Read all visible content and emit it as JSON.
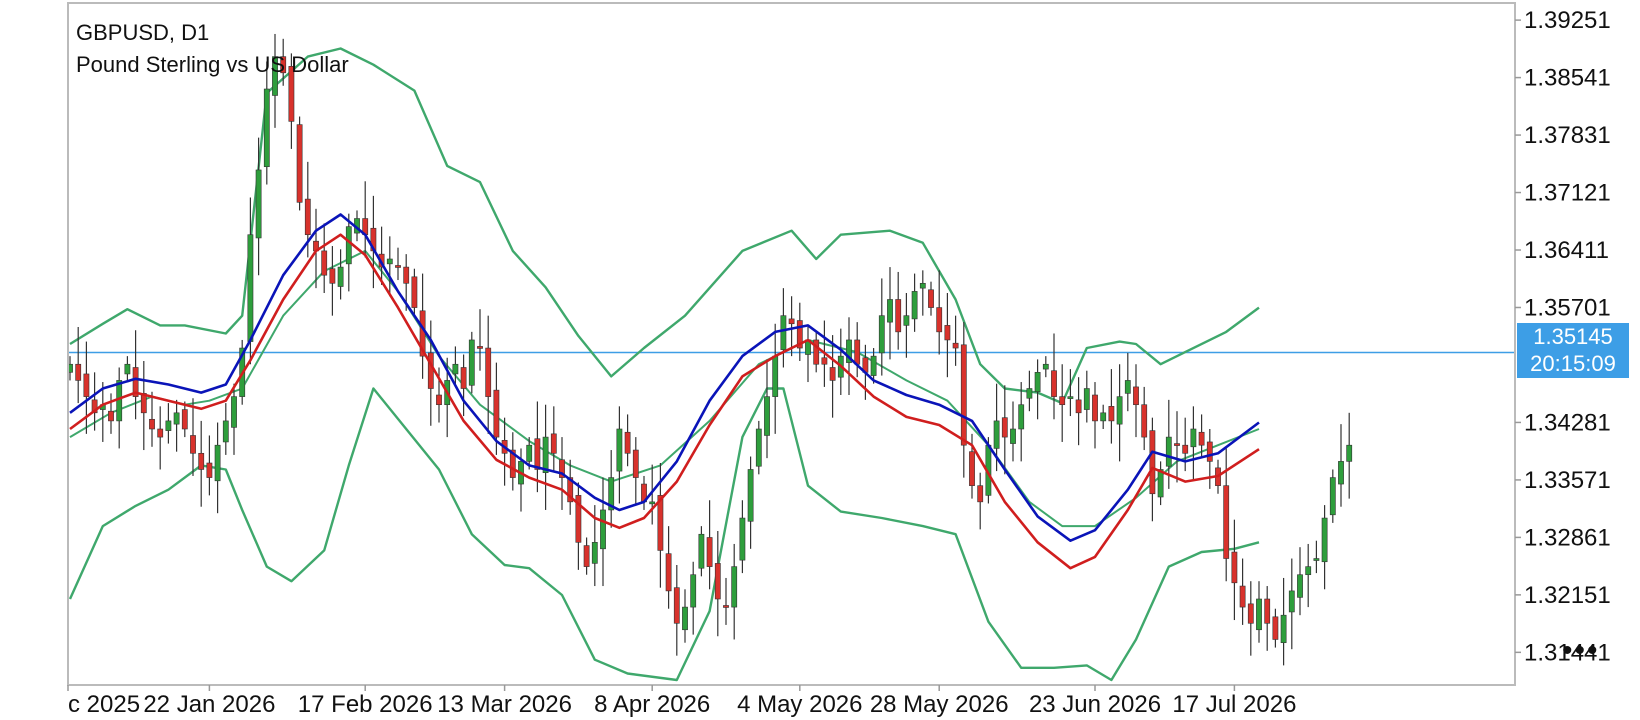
{
  "header": {
    "symbol": "GBPUSD, D1",
    "description": "Pound Sterling vs US Dollar"
  },
  "price_tag": {
    "price": "1.35145",
    "countdown": "20:15:09"
  },
  "menu": {
    "icon": "more-dots-icon",
    "glyph": "•••"
  },
  "colors": {
    "bull": "#2e9e3c",
    "bear": "#d8322c",
    "fast_ma": "#0a14b8",
    "slow_ma": "#d01e1e",
    "bands": "#3fa86c",
    "price_line": "#3d9ee6",
    "frame": "#bbbbbb"
  },
  "chart_data": {
    "type": "candlestick",
    "symbol": "GBPUSD",
    "timeframe": "D1",
    "current_price": 1.35145,
    "ylim": [
      1.3105,
      1.3945
    ],
    "y_ticks": [
      "1.39251",
      "1.38541",
      "1.37831",
      "1.37121",
      "1.36411",
      "1.35701",
      "1.34281",
      "1.33571",
      "1.32861",
      "1.32151",
      "1.31441"
    ],
    "x_ticks": [
      {
        "bar": 0,
        "label": "c 2025"
      },
      {
        "bar": 17,
        "label": "22 Jan 2026"
      },
      {
        "bar": 36,
        "label": "17 Feb 2026"
      },
      {
        "bar": 53,
        "label": "13 Mar 2026"
      },
      {
        "bar": 71,
        "label": "8 Apr 2026"
      },
      {
        "bar": 89,
        "label": "4 May 2026"
      },
      {
        "bar": 106,
        "label": "28 May 2026"
      },
      {
        "bar": 125,
        "label": "23 Jun 2026"
      },
      {
        "bar": 142,
        "label": "17 Jul 2026"
      }
    ],
    "ohlc_closes": [
      1.35,
      1.348,
      1.346,
      1.344,
      1.345,
      1.343,
      1.348,
      1.35,
      1.346,
      1.344,
      1.342,
      1.341,
      1.343,
      1.344,
      1.342,
      1.339,
      1.337,
      1.336,
      1.34,
      1.343,
      1.346,
      1.352,
      1.366,
      1.374,
      1.384,
      1.388,
      1.386,
      1.38,
      1.37,
      1.366,
      1.364,
      1.361,
      1.36,
      1.362,
      1.367,
      1.368,
      1.366,
      1.364,
      1.362,
      1.363,
      1.362,
      1.36,
      1.357,
      1.351,
      1.347,
      1.345,
      1.348,
      1.35,
      1.347,
      1.353,
      1.352,
      1.346,
      1.341,
      1.339,
      1.336,
      1.338,
      1.34,
      1.337,
      1.341,
      1.339,
      1.336,
      1.333,
      1.328,
      1.325,
      1.328,
      1.332,
      1.336,
      1.342,
      1.339,
      1.336,
      1.333,
      1.333,
      1.327,
      1.322,
      1.318,
      1.32,
      1.324,
      1.329,
      1.325,
      1.321,
      1.32,
      1.325,
      1.331,
      1.337,
      1.342,
      1.346,
      1.351,
      1.356,
      1.355,
      1.352,
      1.353,
      1.35,
      1.35,
      1.348,
      1.351,
      1.353,
      1.35,
      1.349,
      1.351,
      1.356,
      1.358,
      1.354,
      1.356,
      1.359,
      1.36,
      1.357,
      1.354,
      1.353,
      1.352,
      1.34,
      1.335,
      1.333,
      1.34,
      1.343,
      1.341,
      1.342,
      1.345,
      1.347,
      1.349,
      1.35,
      1.346,
      1.345,
      1.346,
      1.344,
      1.347,
      1.343,
      1.344,
      1.343,
      1.346,
      1.348,
      1.345,
      1.341,
      1.334,
      1.337,
      1.341,
      1.34,
      1.339,
      1.342,
      1.34,
      1.338,
      1.335,
      1.326,
      1.323,
      1.32,
      1.318,
      1.321,
      1.318,
      1.316,
      1.319,
      1.322,
      1.324,
      1.325,
      1.326,
      1.331,
      1.336,
      1.338,
      1.34
    ],
    "series": [
      {
        "name": "fast MA",
        "color": "fast_ma"
      },
      {
        "name": "slow MA",
        "color": "slow_ma"
      },
      {
        "name": "Bollinger upper",
        "color": "bands"
      },
      {
        "name": "Bollinger middle",
        "color": "bands"
      },
      {
        "name": "Bollinger lower",
        "color": "bands"
      }
    ],
    "bands_upper": [
      [
        0,
        1.3525
      ],
      [
        4,
        1.355
      ],
      [
        7,
        1.3568
      ],
      [
        11,
        1.3548
      ],
      [
        14,
        1.3548
      ],
      [
        19,
        1.3538
      ],
      [
        21,
        1.356
      ],
      [
        24,
        1.3835
      ],
      [
        29,
        1.388
      ],
      [
        33,
        1.389
      ],
      [
        37,
        1.387
      ],
      [
        42,
        1.3838
      ],
      [
        46,
        1.3745
      ],
      [
        50,
        1.3725
      ],
      [
        54,
        1.364
      ],
      [
        58,
        1.3595
      ],
      [
        62,
        1.3535
      ],
      [
        66,
        1.3485
      ],
      [
        70,
        1.352
      ],
      [
        75,
        1.356
      ],
      [
        82,
        1.364
      ],
      [
        88,
        1.3665
      ],
      [
        91,
        1.363
      ],
      [
        94,
        1.366
      ],
      [
        100,
        1.3665
      ],
      [
        104,
        1.365
      ],
      [
        108,
        1.358
      ],
      [
        111,
        1.35
      ],
      [
        114,
        1.347
      ],
      [
        118,
        1.3465
      ],
      [
        121,
        1.3452
      ],
      [
        124,
        1.352
      ],
      [
        128,
        1.3528
      ],
      [
        130,
        1.3525
      ],
      [
        133,
        1.35
      ],
      [
        136,
        1.3515
      ],
      [
        141,
        1.354
      ],
      [
        145,
        1.357
      ]
    ],
    "bands_middle": [
      [
        0,
        1.341
      ],
      [
        5,
        1.344
      ],
      [
        10,
        1.346
      ],
      [
        14,
        1.345
      ],
      [
        17,
        1.3455
      ],
      [
        21,
        1.347
      ],
      [
        26,
        1.356
      ],
      [
        31,
        1.3615
      ],
      [
        36,
        1.364
      ],
      [
        40,
        1.359
      ],
      [
        45,
        1.351
      ],
      [
        50,
        1.345
      ],
      [
        56,
        1.3405
      ],
      [
        61,
        1.3375
      ],
      [
        66,
        1.3355
      ],
      [
        72,
        1.3375
      ],
      [
        78,
        1.343
      ],
      [
        84,
        1.35
      ],
      [
        90,
        1.353
      ],
      [
        96,
        1.3515
      ],
      [
        102,
        1.348
      ],
      [
        107,
        1.3455
      ],
      [
        112,
        1.34
      ],
      [
        117,
        1.333
      ],
      [
        121,
        1.33
      ],
      [
        125,
        1.33
      ],
      [
        130,
        1.3335
      ],
      [
        135,
        1.338
      ],
      [
        140,
        1.34
      ],
      [
        145,
        1.342
      ]
    ],
    "bands_lower": [
      [
        0,
        1.321
      ],
      [
        4,
        1.33
      ],
      [
        8,
        1.3325
      ],
      [
        12,
        1.3345
      ],
      [
        16,
        1.3375
      ],
      [
        19,
        1.337
      ],
      [
        21,
        1.332
      ],
      [
        24,
        1.325
      ],
      [
        27,
        1.3232
      ],
      [
        31,
        1.327
      ],
      [
        34,
        1.3375
      ],
      [
        37,
        1.347
      ],
      [
        41,
        1.342
      ],
      [
        45,
        1.337
      ],
      [
        49,
        1.329
      ],
      [
        53,
        1.3252
      ],
      [
        56,
        1.3248
      ],
      [
        60,
        1.3215
      ],
      [
        64,
        1.3135
      ],
      [
        68,
        1.3118
      ],
      [
        74,
        1.311
      ],
      [
        78,
        1.3195
      ],
      [
        82,
        1.341
      ],
      [
        85,
        1.347
      ],
      [
        87,
        1.347
      ],
      [
        90,
        1.335
      ],
      [
        94,
        1.3318
      ],
      [
        99,
        1.331
      ],
      [
        104,
        1.33
      ],
      [
        108,
        1.329
      ],
      [
        112,
        1.3182
      ],
      [
        116,
        1.3125
      ],
      [
        120,
        1.3125
      ],
      [
        124,
        1.3128
      ],
      [
        127,
        1.311
      ],
      [
        130,
        1.316
      ],
      [
        134,
        1.325
      ],
      [
        138,
        1.3268
      ],
      [
        142,
        1.3272
      ],
      [
        145,
        1.328
      ]
    ],
    "fast_ma": [
      [
        0,
        1.344
      ],
      [
        4,
        1.347
      ],
      [
        8,
        1.3482
      ],
      [
        12,
        1.3475
      ],
      [
        16,
        1.3465
      ],
      [
        19,
        1.3475
      ],
      [
        22,
        1.353
      ],
      [
        26,
        1.361
      ],
      [
        30,
        1.3665
      ],
      [
        33,
        1.3685
      ],
      [
        36,
        1.366
      ],
      [
        40,
        1.359
      ],
      [
        44,
        1.353
      ],
      [
        48,
        1.3455
      ],
      [
        52,
        1.3405
      ],
      [
        56,
        1.3375
      ],
      [
        60,
        1.3365
      ],
      [
        64,
        1.3335
      ],
      [
        67,
        1.332
      ],
      [
        70,
        1.333
      ],
      [
        74,
        1.338
      ],
      [
        78,
        1.3455
      ],
      [
        82,
        1.351
      ],
      [
        86,
        1.354
      ],
      [
        90,
        1.3548
      ],
      [
        94,
        1.3518
      ],
      [
        98,
        1.348
      ],
      [
        102,
        1.3462
      ],
      [
        106,
        1.345
      ],
      [
        110,
        1.343
      ],
      [
        114,
        1.337
      ],
      [
        118,
        1.3312
      ],
      [
        122,
        1.3282
      ],
      [
        125,
        1.3295
      ],
      [
        129,
        1.3345
      ],
      [
        132,
        1.3392
      ],
      [
        136,
        1.338
      ],
      [
        140,
        1.339
      ],
      [
        145,
        1.3428
      ]
    ],
    "slow_ma": [
      [
        0,
        1.342
      ],
      [
        4,
        1.345
      ],
      [
        8,
        1.3465
      ],
      [
        12,
        1.3455
      ],
      [
        16,
        1.3445
      ],
      [
        19,
        1.3455
      ],
      [
        22,
        1.3505
      ],
      [
        26,
        1.358
      ],
      [
        30,
        1.364
      ],
      [
        33,
        1.366
      ],
      [
        36,
        1.3635
      ],
      [
        40,
        1.357
      ],
      [
        44,
        1.35
      ],
      [
        48,
        1.343
      ],
      [
        52,
        1.3382
      ],
      [
        56,
        1.336
      ],
      [
        60,
        1.3345
      ],
      [
        64,
        1.331
      ],
      [
        67,
        1.3298
      ],
      [
        70,
        1.331
      ],
      [
        74,
        1.3355
      ],
      [
        78,
        1.3425
      ],
      [
        82,
        1.3485
      ],
      [
        86,
        1.351
      ],
      [
        90,
        1.353
      ],
      [
        94,
        1.3498
      ],
      [
        98,
        1.346
      ],
      [
        102,
        1.3435
      ],
      [
        106,
        1.3425
      ],
      [
        110,
        1.34
      ],
      [
        114,
        1.333
      ],
      [
        118,
        1.328
      ],
      [
        122,
        1.3248
      ],
      [
        125,
        1.3262
      ],
      [
        129,
        1.332
      ],
      [
        132,
        1.3372
      ],
      [
        136,
        1.3355
      ],
      [
        140,
        1.3362
      ],
      [
        145,
        1.3395
      ]
    ]
  }
}
